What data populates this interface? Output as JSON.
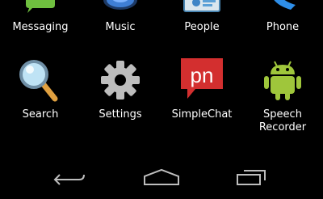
{
  "apps_row1": [
    {
      "label": "Messaging",
      "icon": "messaging-icon"
    },
    {
      "label": "Music",
      "icon": "music-icon"
    },
    {
      "label": "People",
      "icon": "people-icon"
    },
    {
      "label": "Phone",
      "icon": "phone-icon"
    }
  ],
  "apps_row2": [
    {
      "label": "Search",
      "icon": "search-icon"
    },
    {
      "label": "Settings",
      "icon": "gear-icon"
    },
    {
      "label": "SimpleChat",
      "icon": "simplechat-icon",
      "icon_text": "pn"
    },
    {
      "label": "Speech Recorder",
      "icon": "android-icon"
    }
  ],
  "navbar": {
    "back": "back-icon",
    "home": "home-icon",
    "recents": "recents-icon"
  },
  "colors": {
    "background": "#000000",
    "label": "#ffffff",
    "nav": "#bdbdbd",
    "simplechat_red": "#d32f2f",
    "android_green": "#9fc63b"
  }
}
